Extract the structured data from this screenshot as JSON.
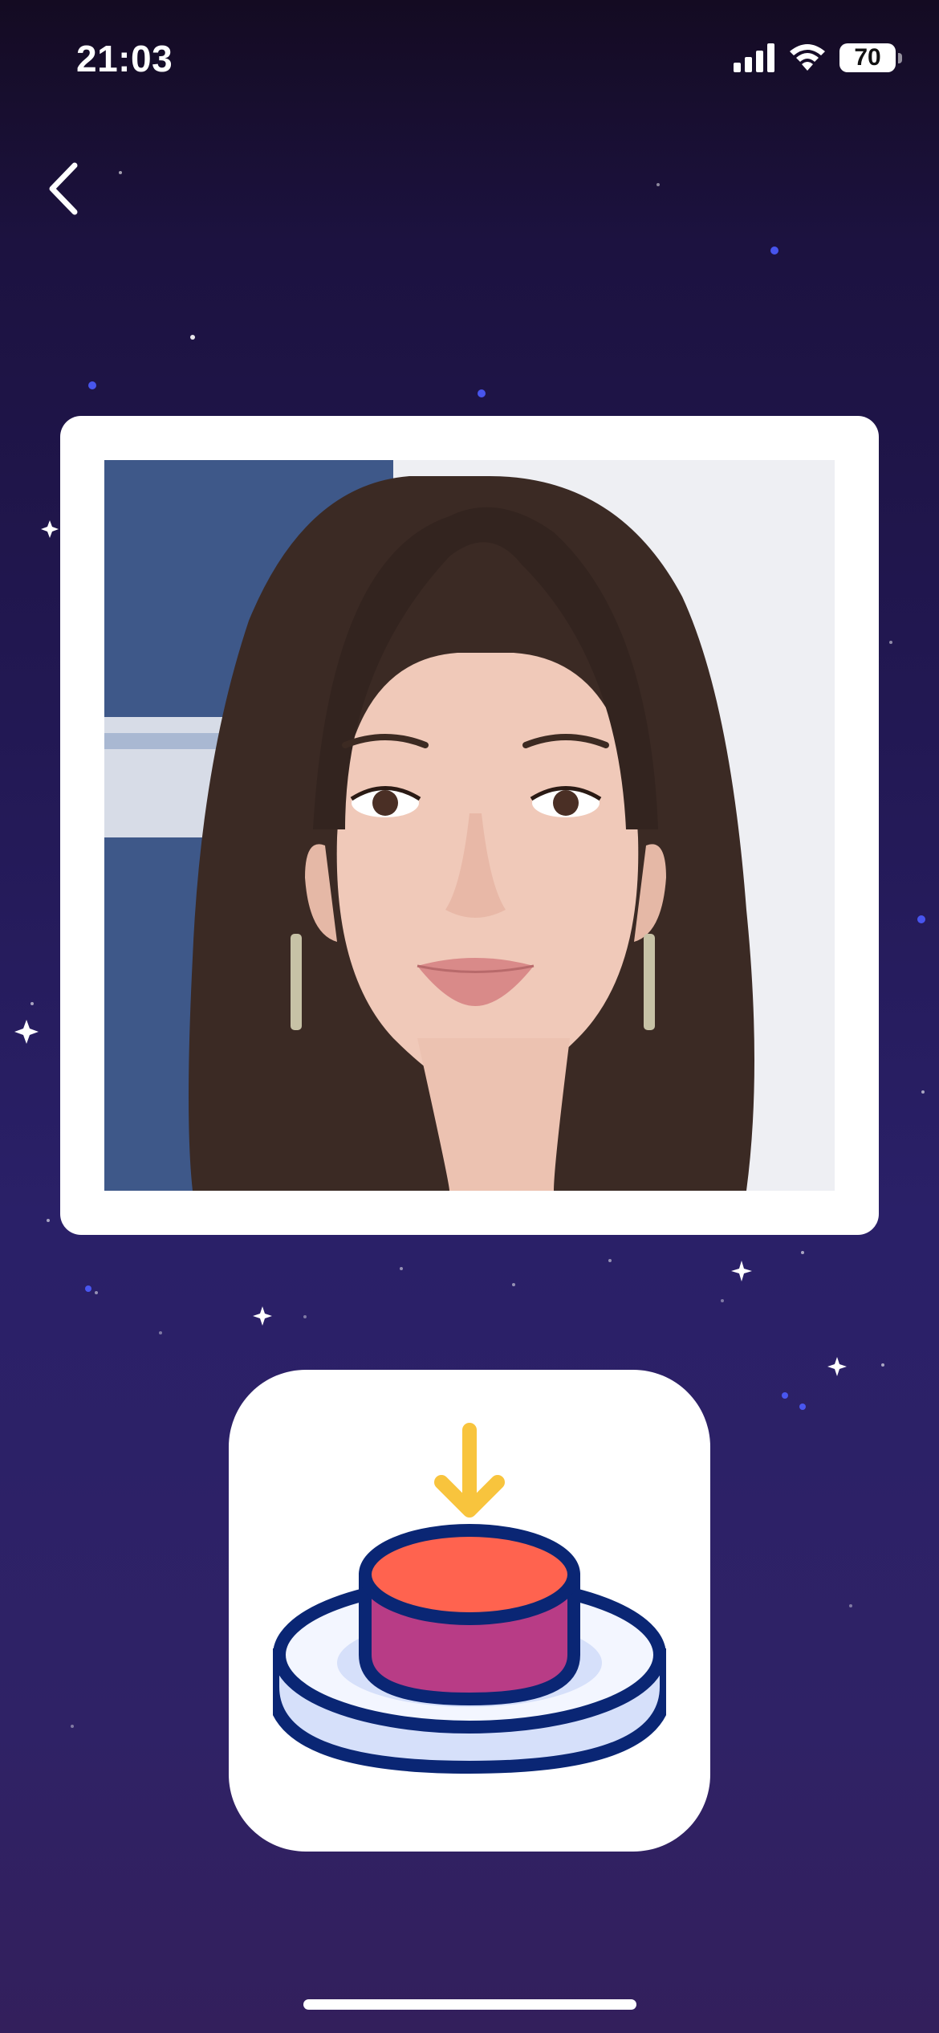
{
  "status_bar": {
    "time": "21:03",
    "battery_level": "70",
    "icons": [
      "cellular-signal-icon",
      "wifi-icon",
      "battery-icon"
    ]
  },
  "navigation": {
    "back_icon": "chevron-left-icon"
  },
  "photo": {
    "description_icon": "portrait-photo"
  },
  "action_tile": {
    "icon": "download-button-icon"
  },
  "colors": {
    "background_top": "#140b22",
    "background_bottom": "#331f5c",
    "card": "#ffffff",
    "arrow_yellow": "#f8c43d",
    "button_top": "#ff634f",
    "button_side": "#b83c86",
    "outline_navy": "#0a2674",
    "plate_fill": "#d6e0fa"
  }
}
